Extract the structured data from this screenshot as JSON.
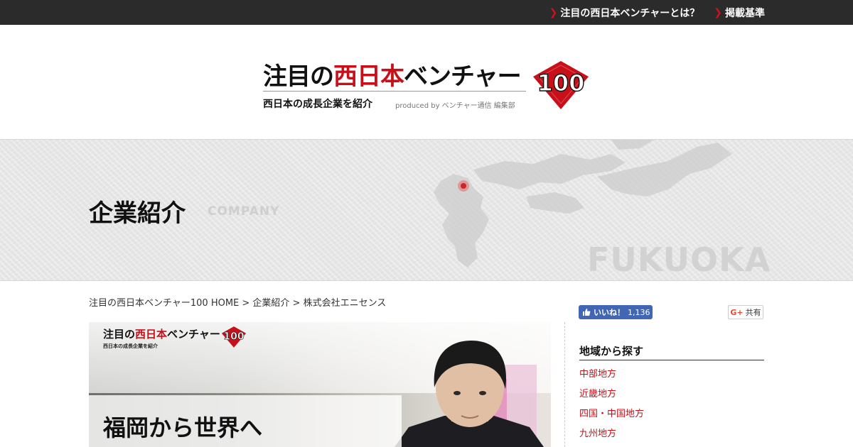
{
  "topnav": [
    {
      "label": "注目の西日本ベンチャーとは？"
    },
    {
      "label": "掲載基準"
    }
  ],
  "logo": {
    "title_pre": "注目の",
    "title_red": "西日本",
    "title_post": "ベンチャー",
    "badge_number": "100",
    "subtitle": "西日本の成長企業を紹介",
    "produced_by": "produced by ベンチャー通信 編集部"
  },
  "hero": {
    "title": "企業紹介",
    "title_en": "COMPANY",
    "city": "FUKUOKA"
  },
  "breadcrumb": "注目の西日本ベンチャー100 HOME > 企業紹介 > 株式会社エニセンス",
  "article_image": {
    "logo_pre": "注目の",
    "logo_red": "西日本",
    "logo_post": "ベンチャー",
    "logo_sub": "西日本の成長企業を紹介",
    "badge_number": "100",
    "headline": "福岡から世界へ"
  },
  "social": {
    "like_label": "いいね！",
    "like_count": "1,136",
    "share_label": "共有",
    "gplus_icon_text": "G+"
  },
  "sidebar": {
    "title": "地域から探す",
    "items": [
      {
        "label": "中部地方"
      },
      {
        "label": "近畿地方"
      },
      {
        "label": "四国・中国地方"
      },
      {
        "label": "九州地方"
      }
    ]
  },
  "colors": {
    "accent_red": "#c8101a",
    "topbar": "#2b2b2b",
    "facebook": "#4267b2"
  }
}
